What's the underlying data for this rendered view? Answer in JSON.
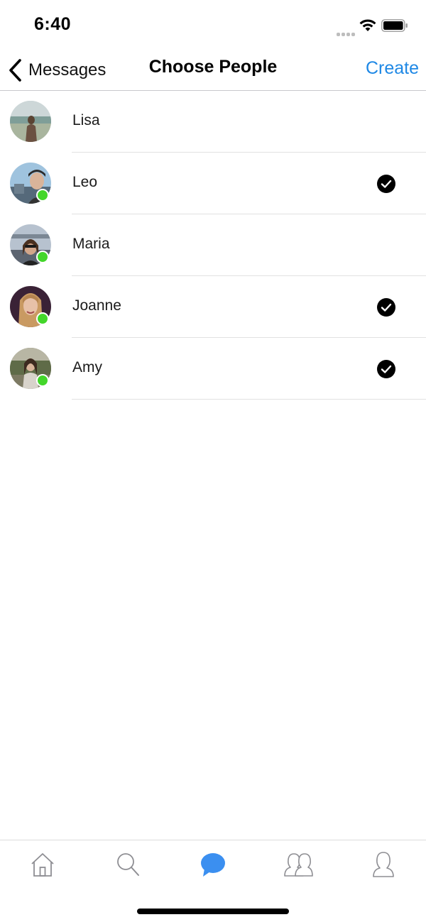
{
  "status_bar": {
    "time": "6:40",
    "signal_icon": "cellular-signal-icon",
    "wifi_icon": "wifi-icon",
    "battery_icon": "battery-icon"
  },
  "nav": {
    "back_label": "Messages",
    "back_icon": "chevron-left-icon",
    "title": "Choose People",
    "create_label": "Create",
    "accent_color": "#1e88e5"
  },
  "people": [
    {
      "name": "Lisa",
      "online": false,
      "selected": false
    },
    {
      "name": "Leo",
      "online": true,
      "selected": true
    },
    {
      "name": "Maria",
      "online": true,
      "selected": false
    },
    {
      "name": "Joanne",
      "online": true,
      "selected": true
    },
    {
      "name": "Amy",
      "online": true,
      "selected": true
    }
  ],
  "online_color": "#43d62a",
  "tab_bar": {
    "tabs": [
      {
        "icon": "home-icon",
        "active": false
      },
      {
        "icon": "search-icon",
        "active": false
      },
      {
        "icon": "chat-bubble-icon",
        "active": true
      },
      {
        "icon": "friends-icon",
        "active": false
      },
      {
        "icon": "profile-icon",
        "active": false
      }
    ],
    "active_color": "#3b8ff0",
    "inactive_color": "#8e8e93"
  }
}
